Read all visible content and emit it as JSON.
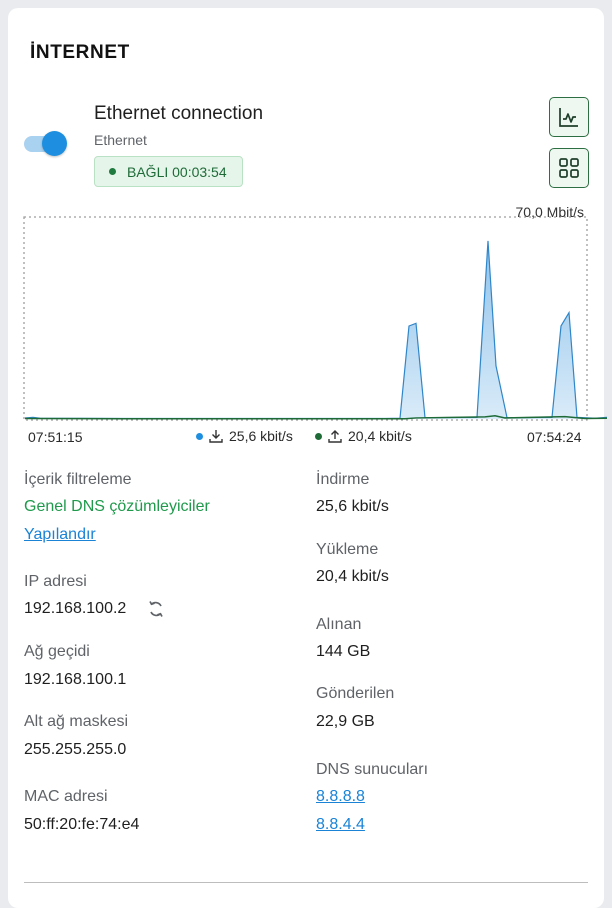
{
  "header": {
    "title": "İNTERNET"
  },
  "connection": {
    "name": "Ethernet connection",
    "type": "Ethernet",
    "status": "BAĞLI 00:03:54",
    "enabled": true,
    "status_color": "#1e7a3e"
  },
  "buttons": {
    "chart": "chart-line-icon",
    "grid": "grid-icon"
  },
  "chart_data": {
    "type": "area",
    "y_max_label": "70,0 Mbit/s",
    "ylim": [
      0,
      70
    ],
    "x_start": "07:51:15",
    "x_end": "07:54:24",
    "series": [
      {
        "name": "25,6 kbit/s",
        "color": "#1e8fe0",
        "icon": "download-icon",
        "points": [
          [
            0,
            0.4
          ],
          [
            8,
            0.6
          ],
          [
            15,
            0.3
          ],
          [
            100,
            0.2
          ],
          [
            200,
            0.2
          ],
          [
            360,
            0.2
          ],
          [
            375,
            0.3
          ],
          [
            384,
            35
          ],
          [
            391,
            36
          ],
          [
            400,
            0.5
          ],
          [
            452,
            0.6
          ],
          [
            463,
            67
          ],
          [
            471,
            20
          ],
          [
            482,
            0.5
          ],
          [
            527,
            0.6
          ],
          [
            536,
            35
          ],
          [
            544,
            40
          ],
          [
            552,
            0.6
          ],
          [
            570,
            0.3
          ],
          [
            582,
            0.6
          ]
        ]
      },
      {
        "name": "20,4 kbit/s",
        "color": "#1e6b38",
        "icon": "upload-icon",
        "points": [
          [
            0,
            0.2
          ],
          [
            100,
            0.1
          ],
          [
            200,
            0.1
          ],
          [
            380,
            0.1
          ],
          [
            391,
            0.4
          ],
          [
            460,
            0.8
          ],
          [
            470,
            1.2
          ],
          [
            480,
            0.4
          ],
          [
            540,
            0.9
          ],
          [
            560,
            0.2
          ],
          [
            582,
            0.3
          ]
        ]
      }
    ]
  },
  "details_left": [
    {
      "label": "İçerik filtreleme",
      "value": "Genel DNS çözümleyiciler",
      "link": "Yapılandır"
    },
    {
      "label": "IP adresi",
      "value": "192.168.100.2"
    },
    {
      "label": "Ağ geçidi",
      "value": "192.168.100.1"
    },
    {
      "label": "Alt ağ maskesi",
      "value": "255.255.255.0"
    },
    {
      "label": "MAC adresi",
      "value": "50:ff:20:fe:74:e4"
    }
  ],
  "details_right": [
    {
      "label": "İndirme",
      "value": "25,6 kbit/s"
    },
    {
      "label": "Yükleme",
      "value": "20,4 kbit/s"
    },
    {
      "label": "Alınan",
      "value": "144 GB"
    },
    {
      "label": "Gönderilen",
      "value": "22,9 GB"
    },
    {
      "label": "DNS sunucuları",
      "values": [
        "8.8.8.8",
        "8.8.4.4"
      ]
    }
  ]
}
